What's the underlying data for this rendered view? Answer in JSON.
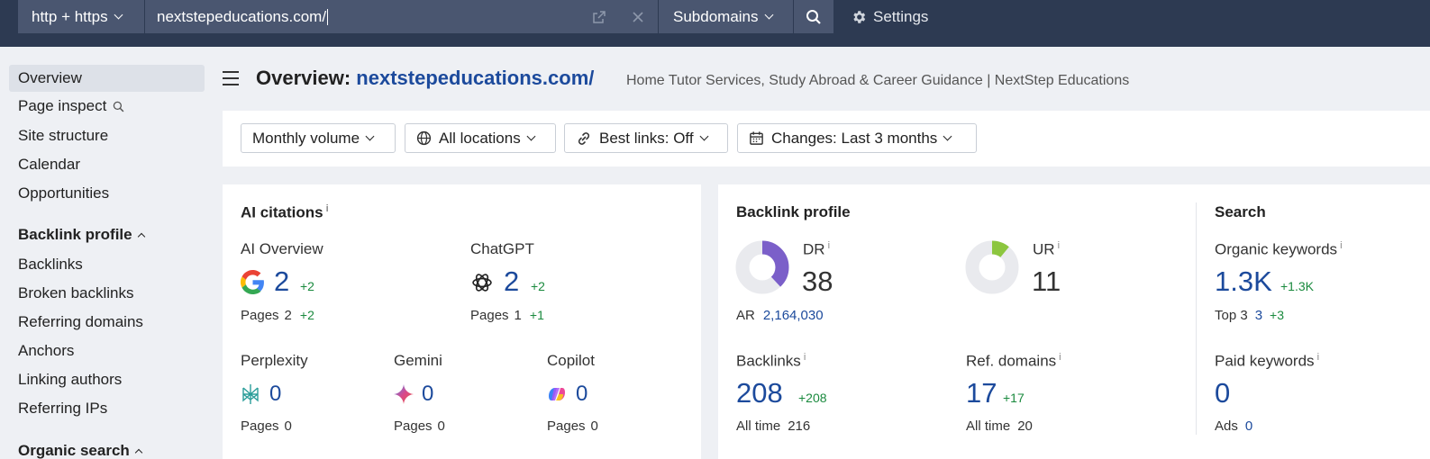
{
  "topbar": {
    "protocol": "http + https",
    "url": "nextstepeducations.com/",
    "mode": "Subdomains",
    "settings": "Settings"
  },
  "sidebar": {
    "items": [
      "Overview",
      "Page inspect",
      "Site structure",
      "Calendar",
      "Opportunities"
    ],
    "backlink_header": "Backlink profile",
    "backlink_items": [
      "Backlinks",
      "Broken backlinks",
      "Referring domains",
      "Anchors",
      "Linking authors",
      "Referring IPs"
    ],
    "organic_header": "Organic search"
  },
  "header": {
    "title_prefix": "Overview:",
    "domain": "nextstepeducations.com/",
    "subtitle": "Home Tutor Services, Study Abroad & Career Guidance | NextStep Educations"
  },
  "filters": {
    "volume": "Monthly volume",
    "locations": "All locations",
    "best_links": "Best links: Off",
    "changes": "Changes: Last 3 months"
  },
  "ai_citations": {
    "title": "AI citations",
    "info": "i",
    "pages_label": "Pages",
    "ai_overview": {
      "label": "AI Overview",
      "value": "2",
      "delta": "+2",
      "pages": "2",
      "pages_delta": "+2"
    },
    "chatgpt": {
      "label": "ChatGPT",
      "value": "2",
      "delta": "+2",
      "pages": "1",
      "pages_delta": "+1"
    },
    "perplexity": {
      "label": "Perplexity",
      "value": "0",
      "pages": "0"
    },
    "gemini": {
      "label": "Gemini",
      "value": "0",
      "pages": "0"
    },
    "copilot": {
      "label": "Copilot",
      "value": "0",
      "pages": "0"
    }
  },
  "backlink_profile": {
    "title": "Backlink profile",
    "dr": {
      "label": "DR",
      "value": "38",
      "ratio": 0.38,
      "color": "#7b5fc9"
    },
    "ur": {
      "label": "UR",
      "value": "11",
      "ratio": 0.11,
      "color": "#8cc63f"
    },
    "ar_label": "AR",
    "ar_value": "2,164,030",
    "backlinks": {
      "label": "Backlinks",
      "value": "208",
      "delta": "+208",
      "alltime_label": "All time",
      "alltime": "216"
    },
    "ref_domains": {
      "label": "Ref. domains",
      "value": "17",
      "delta": "+17",
      "alltime_label": "All time",
      "alltime": "20"
    }
  },
  "search": {
    "title": "Search",
    "organic": {
      "label": "Organic keywords",
      "value": "1.3K",
      "delta": "+1.3K",
      "top3_label": "Top 3",
      "top3": "3",
      "top3_delta": "+3"
    },
    "paid": {
      "label": "Paid keywords",
      "value": "0",
      "ads_label": "Ads",
      "ads": "0"
    }
  },
  "colors": {
    "topbar": "#2d3a52",
    "accent": "#1c4a9c",
    "positive": "#1a8a3e"
  }
}
